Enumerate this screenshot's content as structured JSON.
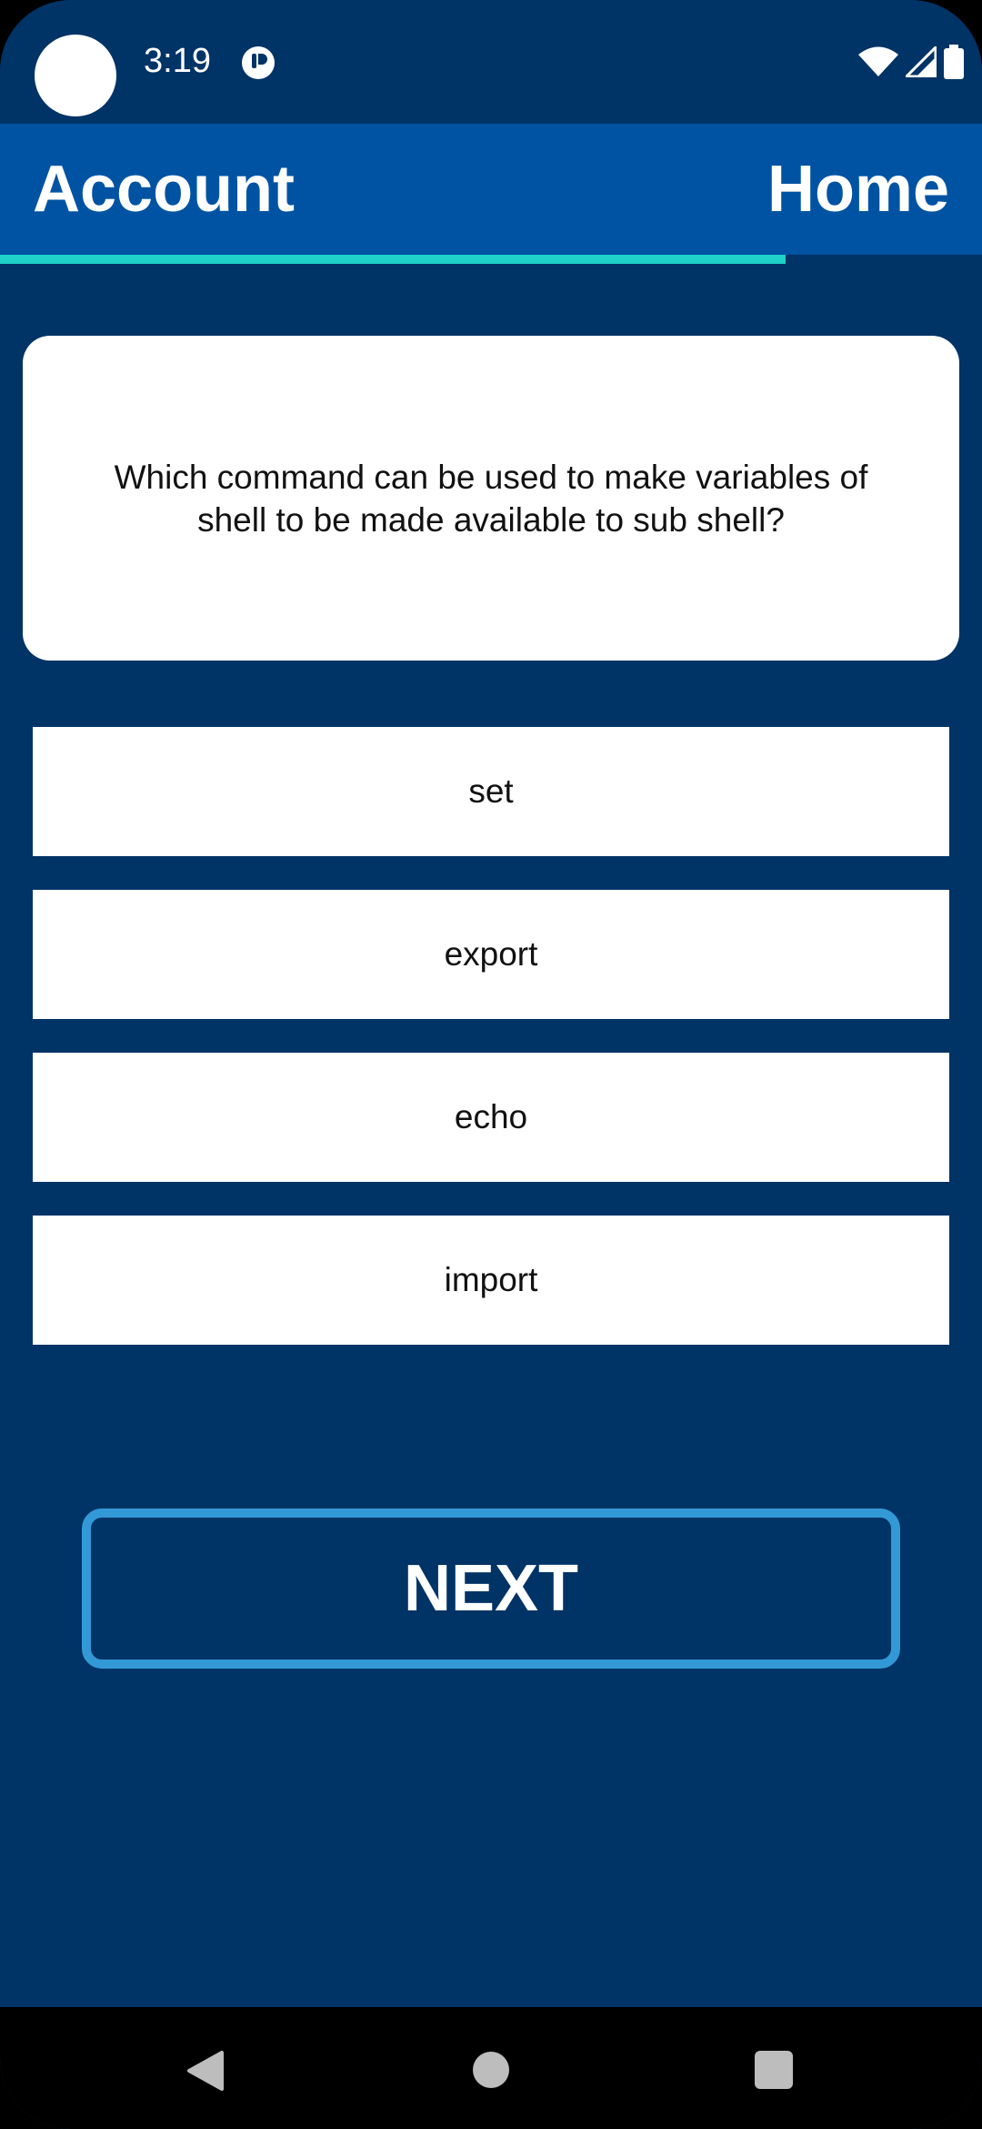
{
  "status_bar": {
    "time": "3:19",
    "icons": [
      "app-notification-icon",
      "wifi-icon",
      "signal-icon",
      "battery-icon"
    ]
  },
  "tabs": {
    "account_label": "Account",
    "home_label": "Home"
  },
  "progress": {
    "fraction": 0.8
  },
  "question": {
    "text": "Which command can be used to make variables of shell to be made available to sub shell?"
  },
  "answers": [
    {
      "label": "set"
    },
    {
      "label": "export"
    },
    {
      "label": "echo"
    },
    {
      "label": "import"
    }
  ],
  "next_button": {
    "label": "NEXT"
  },
  "nav_bar": {
    "icons": [
      "back-icon",
      "home-icon",
      "recents-icon"
    ]
  },
  "colors": {
    "background": "#003366",
    "app_bar": "#0053a3",
    "progress": "#1fd1c9",
    "next_border": "#3399d6"
  }
}
